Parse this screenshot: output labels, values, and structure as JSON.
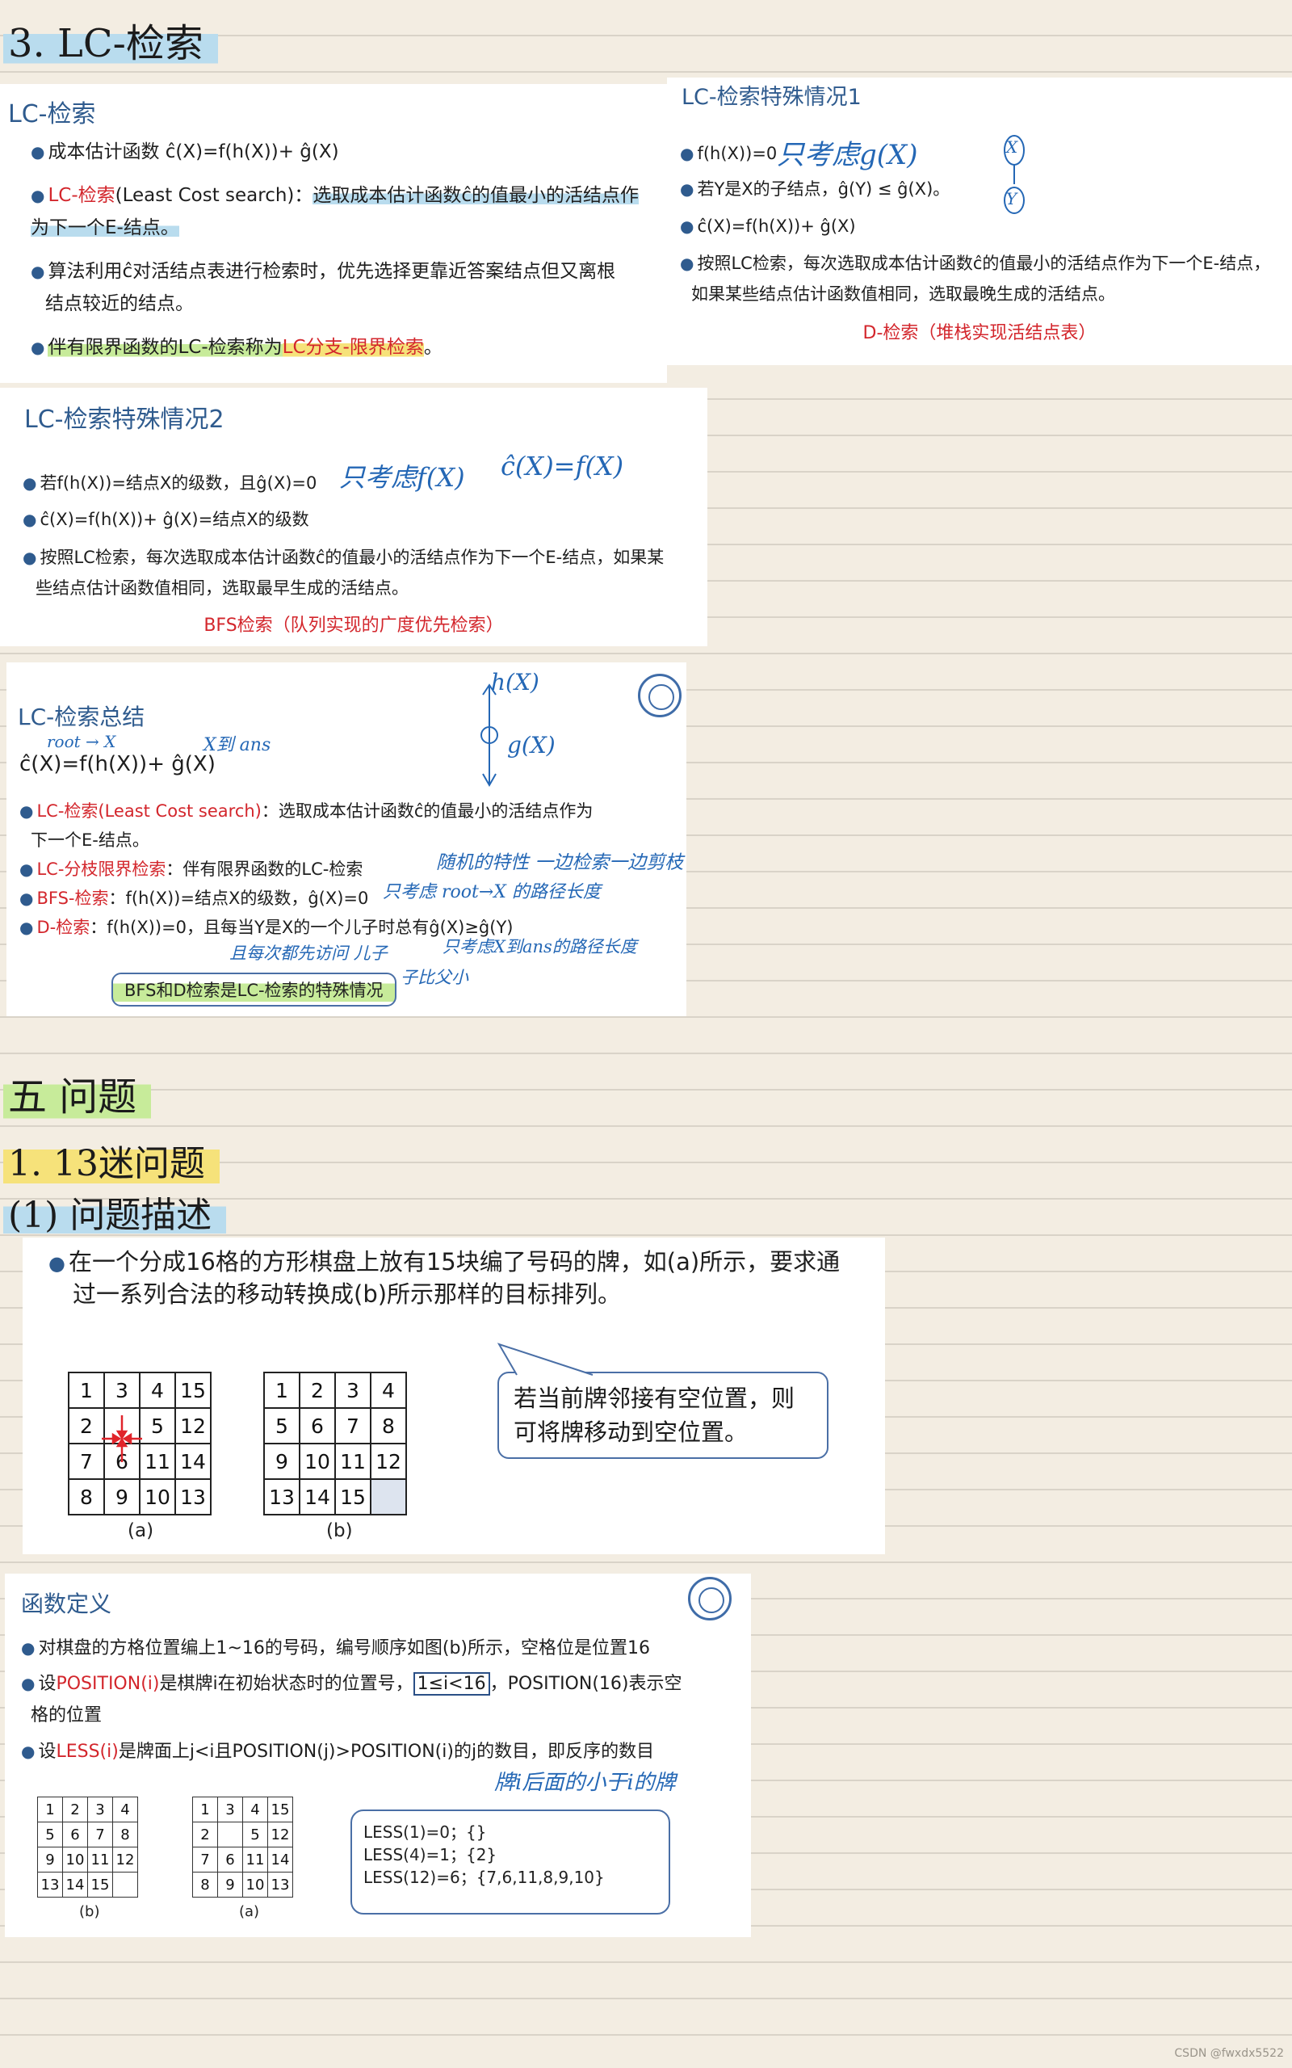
{
  "headings": {
    "h3": "3. LC-检索",
    "h5": "五 问题",
    "h1": "1. 13迷问题",
    "hdesc": "(1) 问题描述"
  },
  "slide_a": {
    "title": "LC-检索",
    "b1": "成本估计函数 ĉ(X)=f(h(X))+ ĝ(X)",
    "b2_red": "LC-检索",
    "b2_rest": "(Least Cost search)：",
    "b2_hl": "选取成本估计函数ĉ的值最小的活结点作",
    "b2_line2": "为下一个E-结点。",
    "b3_l1": "算法利用ĉ对活结点表进行检索时，优先选择更靠近答案结点但又离根",
    "b3_l2": "结点较近的结点。",
    "b4_a": "伴有限界函数的LC-检索称为",
    "b4_red": "LC分支-限界检索",
    "b4_end": "。"
  },
  "slide_b": {
    "title": "LC-检索特殊情况1",
    "b1": "f(h(X))=0",
    "note1": "只考虑g(X)",
    "b2": "若Y是X的子结点，ĝ(Y) ≤ ĝ(X)。",
    "b3": "ĉ(X)=f(h(X))+ ĝ(X)",
    "b4_l1": "按照LC检索，每次选取成本估计函数ĉ的值最小的活结点作为下一个E-结点，",
    "b4_l2": "如果某些结点估计函数值相同，选取最晚生成的活结点。",
    "footer": "D-检索（堆栈实现活结点表）",
    "tree_top": "X",
    "tree_bottom": "Y"
  },
  "slide_c": {
    "title": "LC-检索特殊情况2",
    "b1": "若f(h(X))=结点X的级数，且ĝ(X)=0",
    "note1": "只考虑f(X)",
    "note2": "ĉ(X)=f(X)",
    "b2": "ĉ(X)=f(h(X))+ ĝ(X)=结点X的级数",
    "b3_l1": "按照LC检索，每次选取成本估计函数ĉ的值最小的活结点作为下一个E-结点，如果某",
    "b3_l2": "些结点估计函数值相同，选取最早生成的活结点。",
    "footer": "BFS检索（队列实现的广度优先检索）"
  },
  "slide_d": {
    "title": "LC-检索总结",
    "formula": "ĉ(X)=f(h(X))+ ĝ(X)",
    "note_root": "root → X",
    "note_ans": "X到 ans",
    "note_hx": "h(X)",
    "note_gx": "g(X)",
    "b1_red": "LC-检索(Least Cost search)",
    "b1_rest": "：选取成本估计函数ĉ的值最小的活结点作为",
    "b1_l2": "下一个E-结点。",
    "b2_red": "LC-分枝限界检索",
    "b2_rest": "：伴有限界函数的LC-检索",
    "b2_note": "随机的特性 一边检索一边剪枝",
    "b3_red": "BFS-检索",
    "b3_rest": "：f(h(X))=结点X的级数，ĝ(X)=0",
    "b3_note": "只考虑 root→X 的路径长度",
    "b4_red": "D-检索",
    "b4_rest": "：f(h(X))=0，且每当Y是X的一个儿子时总有ĝ(X)≥ĝ(Y)",
    "b4_note1": "且每次都先访问 儿子",
    "b4_note2": "只考虑X到ans的路径长度",
    "b4_note3": "子比父小",
    "box": "BFS和D检索是LC-检索的特殊情况"
  },
  "slide_e": {
    "bullet_l1": "在一个分成16格的方形棋盘上放有15块编了号码的牌，如(a)所示，要求通",
    "bullet_l2": "过一系列合法的移动转换成(b)所示那样的目标排列。",
    "grid_a": [
      [
        "1",
        "3",
        "4",
        "15"
      ],
      [
        "2",
        "",
        "5",
        "12"
      ],
      [
        "7",
        "6",
        "11",
        "14"
      ],
      [
        "8",
        "9",
        "10",
        "13"
      ]
    ],
    "grid_b": [
      [
        "1",
        "2",
        "3",
        "4"
      ],
      [
        "5",
        "6",
        "7",
        "8"
      ],
      [
        "9",
        "10",
        "11",
        "12"
      ],
      [
        "13",
        "14",
        "15",
        ""
      ]
    ],
    "cap_a": "(a)",
    "cap_b": "(b)",
    "bubble_l1": "若当前牌邻接有空位置，则",
    "bubble_l2": "可将牌移动到空位置。"
  },
  "slide_f": {
    "title": "函数定义",
    "b1": "对棋盘的方格位置编上1~16的号码，编号顺序如图(b)所示，空格位是位置16",
    "b2_a": "设",
    "b2_red": "POSITION(i)",
    "b2_b": "是棋牌i在初始状态时的位置号，",
    "b2_box": "1≤i<16",
    "b2_c": "，POSITION(16)表示空",
    "b2_l2": "格的位置",
    "b3_a": "设",
    "b3_red": "LESS(i)",
    "b3_b": "是牌面上j<i且POSITION(j)>POSITION(i)的j的数目，即反序的数目",
    "b3_note": "牌i后面的小于i的牌",
    "grid_b": [
      [
        "1",
        "2",
        "3",
        "4"
      ],
      [
        "5",
        "6",
        "7",
        "8"
      ],
      [
        "9",
        "10",
        "11",
        "12"
      ],
      [
        "13",
        "14",
        "15",
        ""
      ]
    ],
    "grid_a": [
      [
        "1",
        "3",
        "4",
        "15"
      ],
      [
        "2",
        "",
        "5",
        "12"
      ],
      [
        "7",
        "6",
        "11",
        "14"
      ],
      [
        "8",
        "9",
        "10",
        "13"
      ]
    ],
    "cap_b": "(b)",
    "cap_a": "(a)",
    "less1": "LESS(1)=0；{}",
    "less2": "LESS(4)=1；{2}",
    "less3": "LESS(12)=6；{7,6,11,8,9,10}"
  },
  "watermark": "CSDN @fwxdx5522"
}
